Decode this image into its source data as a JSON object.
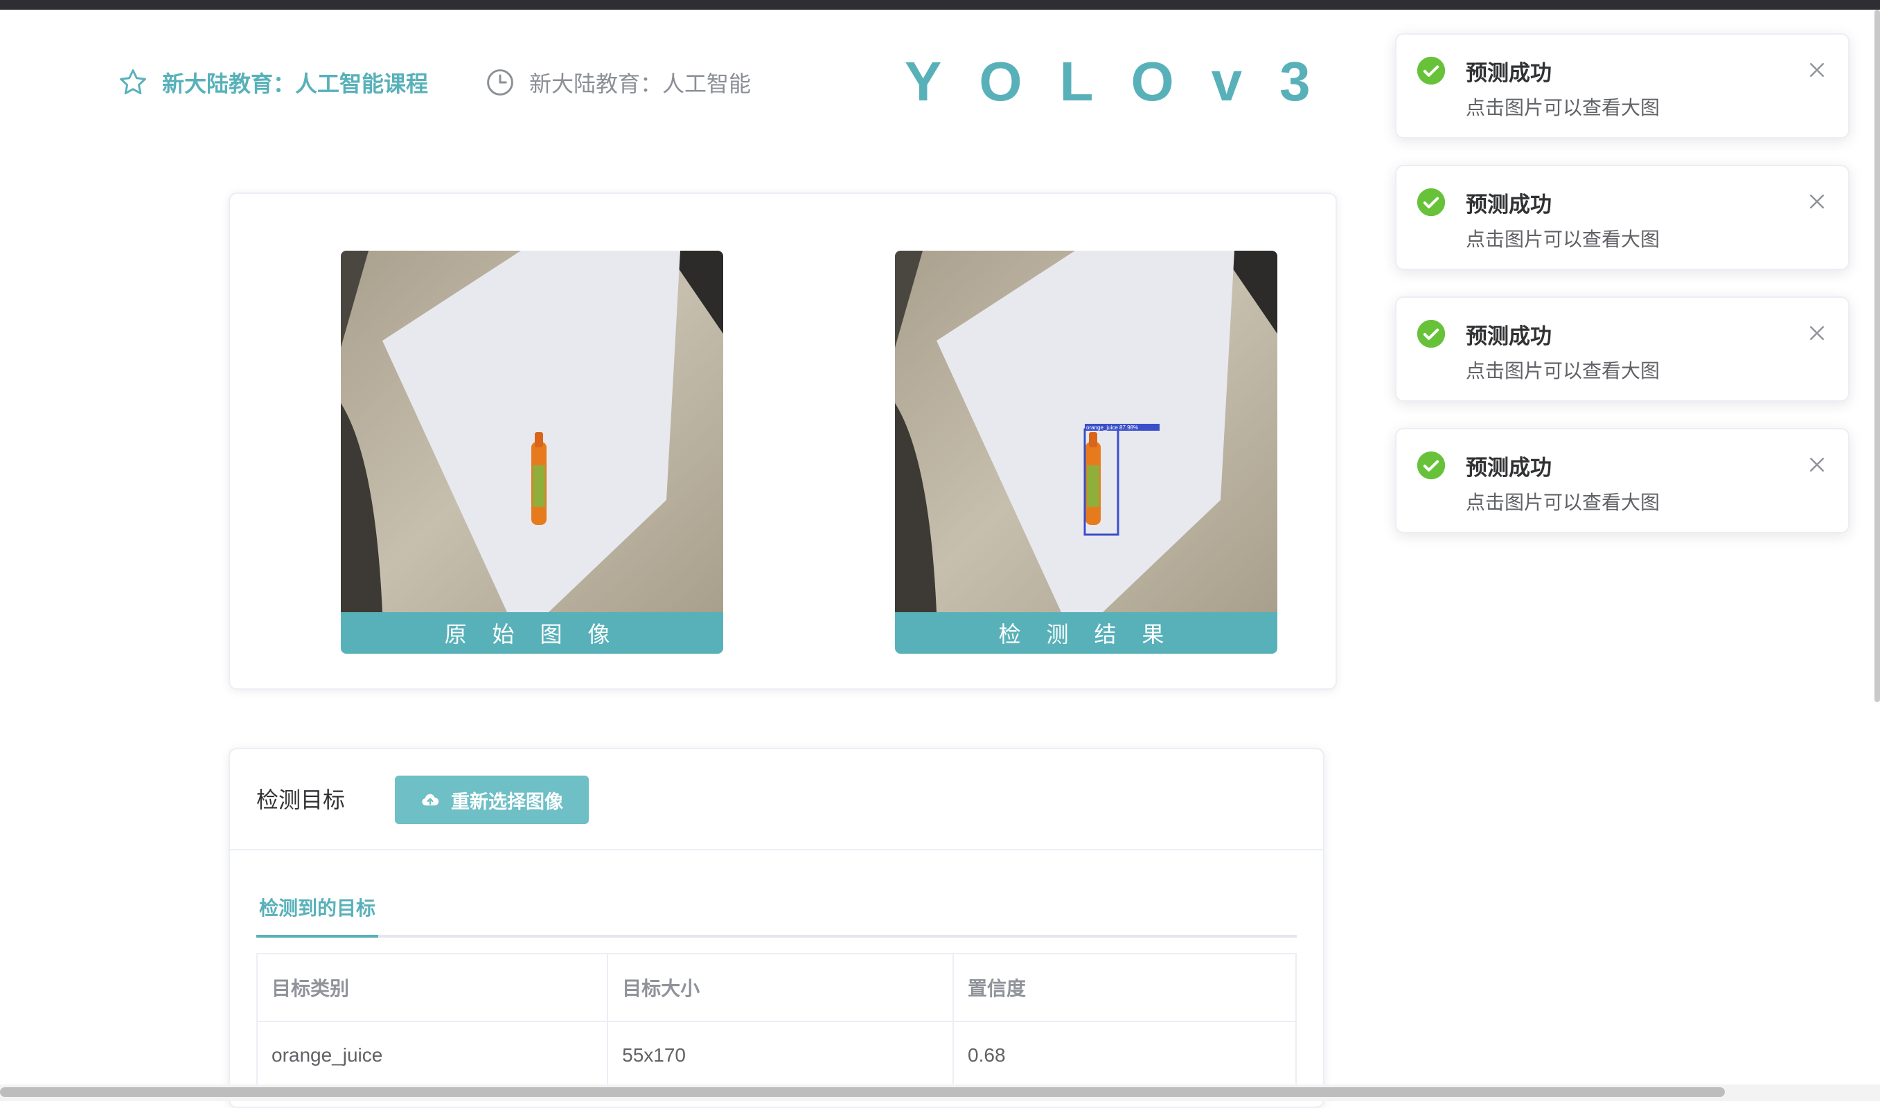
{
  "header": {
    "link_active": "新大陆教育：人工智能课程",
    "link_inactive": "新大陆教育：人工智能",
    "brand_title": "YOLOv3 –",
    "icons": {
      "active": "star-icon",
      "inactive": "clock-icon"
    }
  },
  "images": {
    "original_caption": "原 始 图 像",
    "result_caption": "检 测 结 果",
    "result_box_label": "orange_juice 87.98%"
  },
  "detection": {
    "title": "检测目标",
    "reselect_button": "重新选择图像",
    "reselect_icon": "cloud-upload-icon",
    "tab_label": "检测到的目标",
    "columns": [
      "目标类别",
      "目标大小",
      "置信度"
    ],
    "rows": [
      [
        "orange_juice",
        "55x170",
        "0.68"
      ]
    ]
  },
  "notifications": [
    {
      "title": "预测成功",
      "message": "点击图片可以查看大图"
    },
    {
      "title": "预测成功",
      "message": "点击图片可以查看大图"
    },
    {
      "title": "预测成功",
      "message": "点击图片可以查看大图"
    },
    {
      "title": "预测成功",
      "message": "点击图片可以查看大图"
    }
  ],
  "colors": {
    "accent": "#58b1b9",
    "button": "#6ebfc6",
    "success": "#67c23a",
    "topbar": "#2f2f33"
  }
}
